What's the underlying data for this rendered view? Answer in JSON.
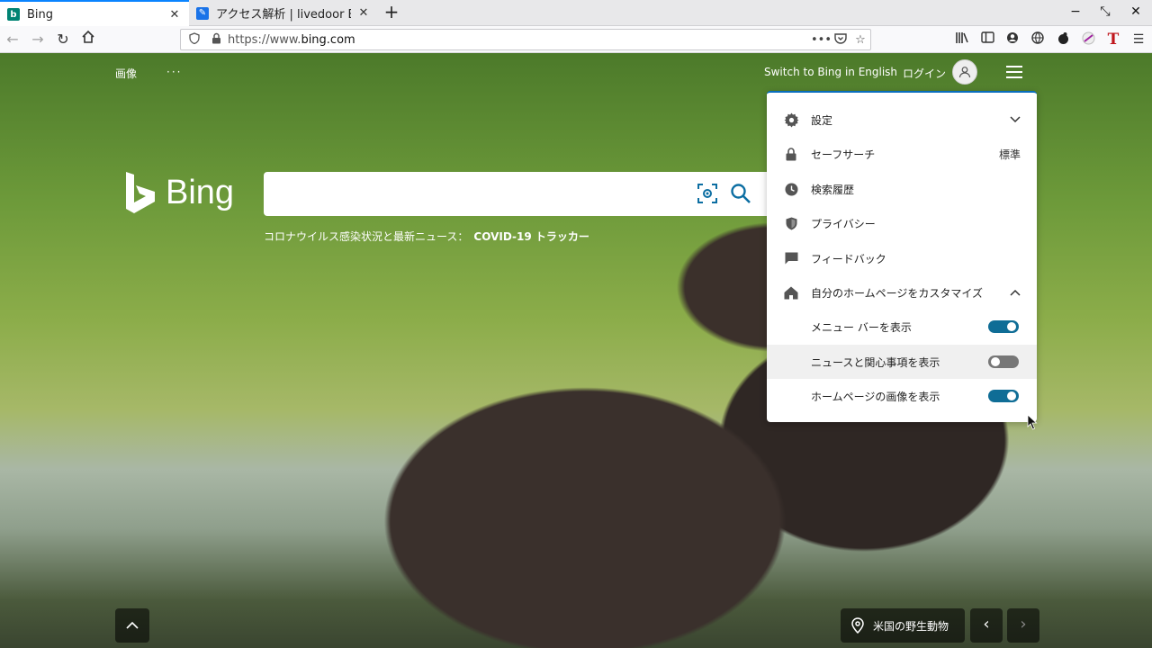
{
  "browser": {
    "tabs": [
      {
        "title": "Bing",
        "favicon_color": "#008373",
        "favicon_glyph": "b",
        "active": true
      },
      {
        "title": "アクセス解析 | livedoor Blo",
        "favicon_color": "#1a73e8",
        "favicon_glyph": "✎",
        "active": false
      }
    ],
    "new_tab_label": "+",
    "window_controls": {
      "minimize": "−",
      "restore": "⤡",
      "close": "✕"
    },
    "url_prefix": "https://www.",
    "url_domain": "bing.com",
    "url_more": "•••"
  },
  "page": {
    "top_links": {
      "images": "画像",
      "more": "···",
      "switch_lang": "Switch to Bing in English",
      "login": "ログイン"
    },
    "logo_text": "Bing",
    "search": {
      "placeholder": ""
    },
    "covid": {
      "prefix": "コロナウイルス感染状況と最新ニュース：",
      "link": "COVID-19 トラッカー"
    },
    "bottom": {
      "info_label": "米国の野生動物",
      "prev": "‹",
      "next": "›",
      "up": "︿"
    }
  },
  "menu": {
    "items": [
      {
        "label": "設定",
        "icon": "gear-icon",
        "right": "chevron-down"
      },
      {
        "label": "セーフサーチ",
        "icon": "lock-icon",
        "right_text": "標準"
      },
      {
        "label": "検索履歴",
        "icon": "clock-icon"
      },
      {
        "label": "プライバシー",
        "icon": "shield-icon"
      },
      {
        "label": "フィードバック",
        "icon": "chat-icon"
      },
      {
        "label": "自分のホームページをカスタマイズ",
        "icon": "home-icon",
        "right": "chevron-up"
      }
    ],
    "toggles": [
      {
        "label": "メニュー バーを表示",
        "on": true
      },
      {
        "label": "ニュースと関心事項を表示",
        "on": false
      },
      {
        "label": "ホームページの画像を表示",
        "on": true
      }
    ]
  },
  "colors": {
    "accent": "#0f6d96",
    "tab_active_border": "#0a84ff"
  }
}
